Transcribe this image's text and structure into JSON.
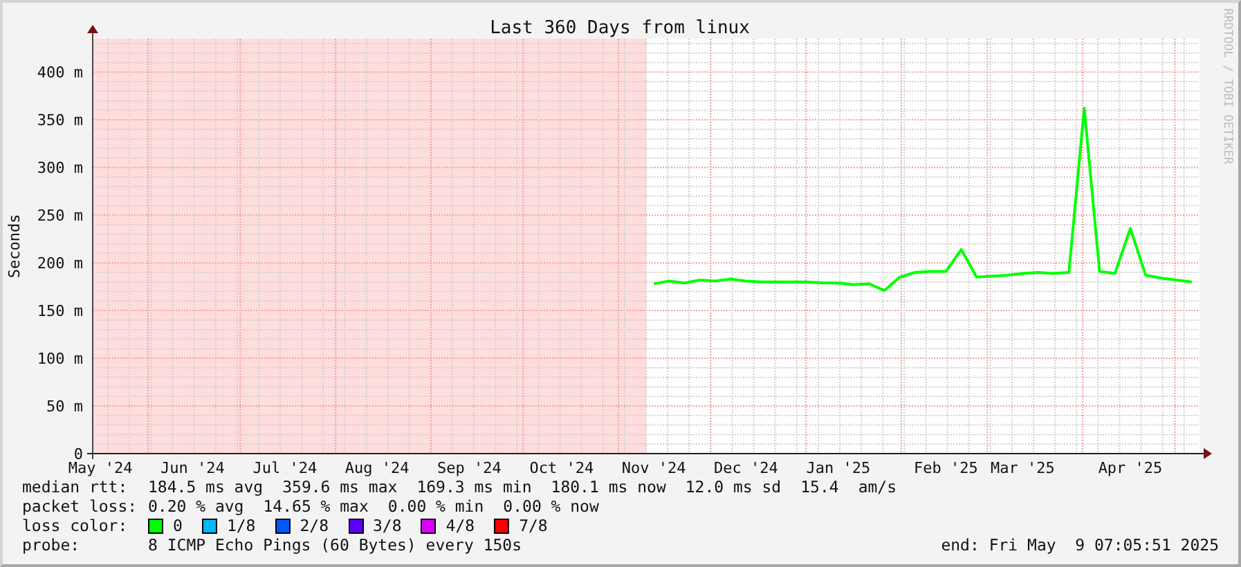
{
  "graph": {
    "credit": "RRDTOOL / TOBI OETIKER",
    "chart_data": {
      "type": "line",
      "title": "Last 360 Days from linux",
      "ylabel": "Seconds",
      "grid": true,
      "ylim": [
        0,
        435
      ],
      "categories": [
        "May '24",
        null,
        null,
        null,
        null,
        null,
        "Jun '24",
        null,
        null,
        null,
        null,
        null,
        "Jul '24",
        null,
        null,
        null,
        null,
        null,
        "Aug '24",
        null,
        null,
        null,
        null,
        null,
        "Sep '24",
        null,
        null,
        null,
        null,
        null,
        "Oct '24",
        null,
        null,
        null,
        null,
        null,
        "Nov '24",
        null,
        null,
        null,
        null,
        null,
        "Dec '24",
        null,
        null,
        null,
        null,
        null,
        "Jan '25",
        null,
        null,
        null,
        null,
        null,
        null,
        "Feb '25",
        null,
        null,
        null,
        null,
        "Mar '25",
        null,
        null,
        null,
        null,
        null,
        null,
        "Apr '25",
        null,
        null,
        null,
        null
      ],
      "yticks": [
        {
          "value": 0,
          "label": "0"
        },
        {
          "value": 50,
          "label": "50 m"
        },
        {
          "value": 100,
          "label": "100 m"
        },
        {
          "value": 150,
          "label": "150 m"
        },
        {
          "value": 200,
          "label": "200 m"
        },
        {
          "value": 250,
          "label": "250 m"
        },
        {
          "value": 300,
          "label": "300 m"
        },
        {
          "value": 350,
          "label": "350 m"
        },
        {
          "value": 400,
          "label": "400 m"
        }
      ],
      "series": [
        {
          "color": "#00ff00",
          "values": [
            null,
            null,
            null,
            null,
            null,
            null,
            null,
            null,
            null,
            null,
            null,
            null,
            null,
            null,
            null,
            null,
            null,
            null,
            null,
            null,
            null,
            null,
            null,
            null,
            null,
            null,
            null,
            null,
            null,
            null,
            null,
            null,
            null,
            null,
            null,
            null,
            178,
            181,
            179,
            182,
            181,
            183,
            181,
            180,
            180,
            180,
            180,
            179,
            179,
            177,
            178,
            171,
            185,
            190,
            191,
            191,
            214,
            185,
            186,
            187,
            189,
            190,
            189,
            190,
            362,
            191,
            189,
            236,
            187,
            184,
            182,
            180
          ]
        }
      ]
    }
  },
  "legend": {
    "rows": [
      {
        "kind": "stats",
        "label": "median rtt:",
        "values": [
          "184.5 ms avg",
          "359.6 ms max",
          "169.3 ms min",
          "180.1 ms now",
          "12.0 ms sd",
          "15.4",
          "am/s"
        ]
      },
      {
        "kind": "stats",
        "label": "packet loss:",
        "values": [
          "0.20 % avg",
          "14.65 % max",
          "0.00 % min",
          "0.00 % now"
        ]
      },
      {
        "kind": "swatches",
        "label": "loss color:",
        "items": [
          {
            "label": "0",
            "color": "#00ff00"
          },
          {
            "label": "1/8",
            "color": "#00b8ff"
          },
          {
            "label": "2/8",
            "color": "#0059ff"
          },
          {
            "label": "3/8",
            "color": "#5e00ff"
          },
          {
            "label": "4/8",
            "color": "#dd00ff"
          },
          {
            "label": "7/8",
            "color": "#ff0000"
          }
        ]
      },
      {
        "kind": "stats",
        "label": "probe:",
        "values": [
          "8 ICMP Echo Pings (60 Bytes) every 150s"
        ]
      }
    ],
    "end": "end: Fri May  9 07:05:51 2025"
  }
}
